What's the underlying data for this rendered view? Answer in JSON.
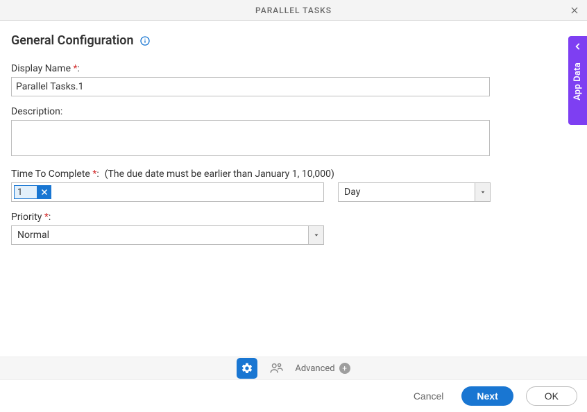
{
  "titlebar": {
    "title": "PARALLEL TASKS"
  },
  "section": {
    "title": "General Configuration"
  },
  "fields": {
    "displayName": {
      "label": "Display Name",
      "value": "Parallel Tasks.1"
    },
    "description": {
      "label": "Description",
      "value": ""
    },
    "timeToComplete": {
      "label": "Time To Complete",
      "hint": "(The due date must be earlier than January 1, 10,000)",
      "value": "1",
      "unit": "Day"
    },
    "priority": {
      "label": "Priority",
      "value": "Normal"
    }
  },
  "colon": ":",
  "sidetab": {
    "label": "App Data"
  },
  "toolbar": {
    "advanced_label": "Advanced"
  },
  "footer": {
    "cancel": "Cancel",
    "next": "Next",
    "ok": "OK"
  }
}
